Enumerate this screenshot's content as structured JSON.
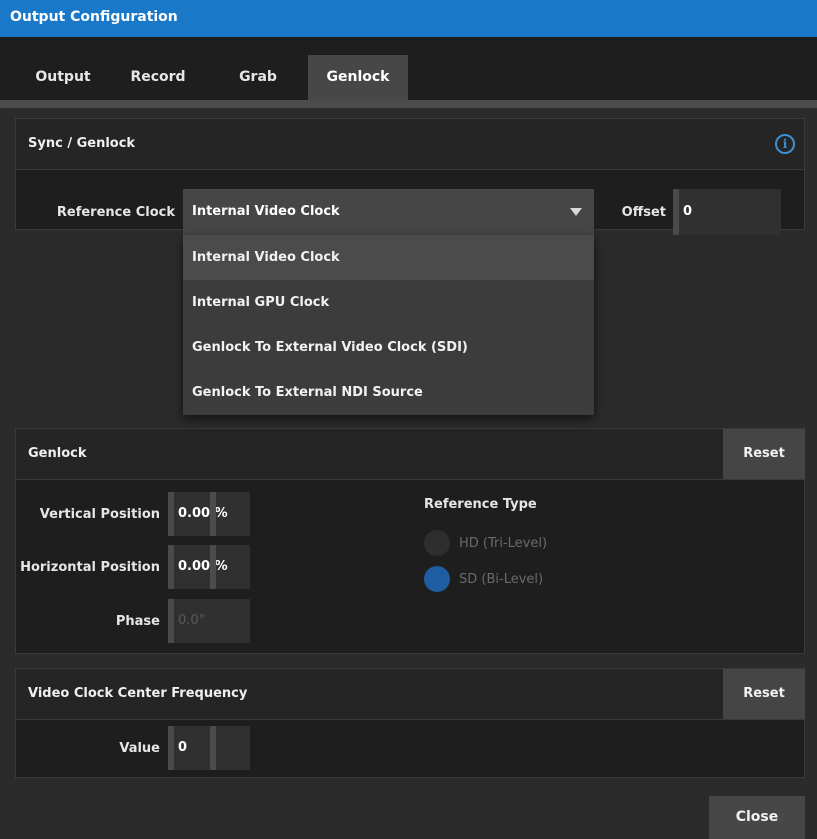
{
  "window": {
    "title": "Output Configuration"
  },
  "tabs": [
    {
      "label": "Output"
    },
    {
      "label": "Record"
    },
    {
      "label": "Grab"
    },
    {
      "label": "Genlock",
      "active": true
    }
  ],
  "sync": {
    "header": "Sync / Genlock",
    "reference_clock_label": "Reference Clock",
    "reference_clock_value": "Internal Video Clock",
    "offset_label": "Offset",
    "offset_value": "0",
    "options": [
      "Internal Video Clock",
      "Internal GPU Clock",
      "Genlock To External Video Clock (SDI)",
      "Genlock To External NDI Source"
    ]
  },
  "genlock": {
    "header": "Genlock",
    "reset_label": "Reset",
    "vertical_label": "Vertical Position",
    "vertical_value": "0.00 %",
    "horizontal_label": "Horizontal Position",
    "horizontal_value": "0.00 %",
    "phase_label": "Phase",
    "phase_value": "0.0°",
    "reference_type_label": "Reference Type",
    "ref_options": [
      {
        "label": "HD (Tri-Level)",
        "selected": false
      },
      {
        "label": "SD (Bi-Level)",
        "selected": true
      }
    ]
  },
  "vccf": {
    "header": "Video Clock Center Frequency",
    "reset_label": "Reset",
    "value_label": "Value",
    "value": "0"
  },
  "footer": {
    "close_label": "Close"
  },
  "colors": {
    "accent": "#1a78c8",
    "radio_selected": "#1d5ea3",
    "info_icon": "#3a8fd6"
  }
}
